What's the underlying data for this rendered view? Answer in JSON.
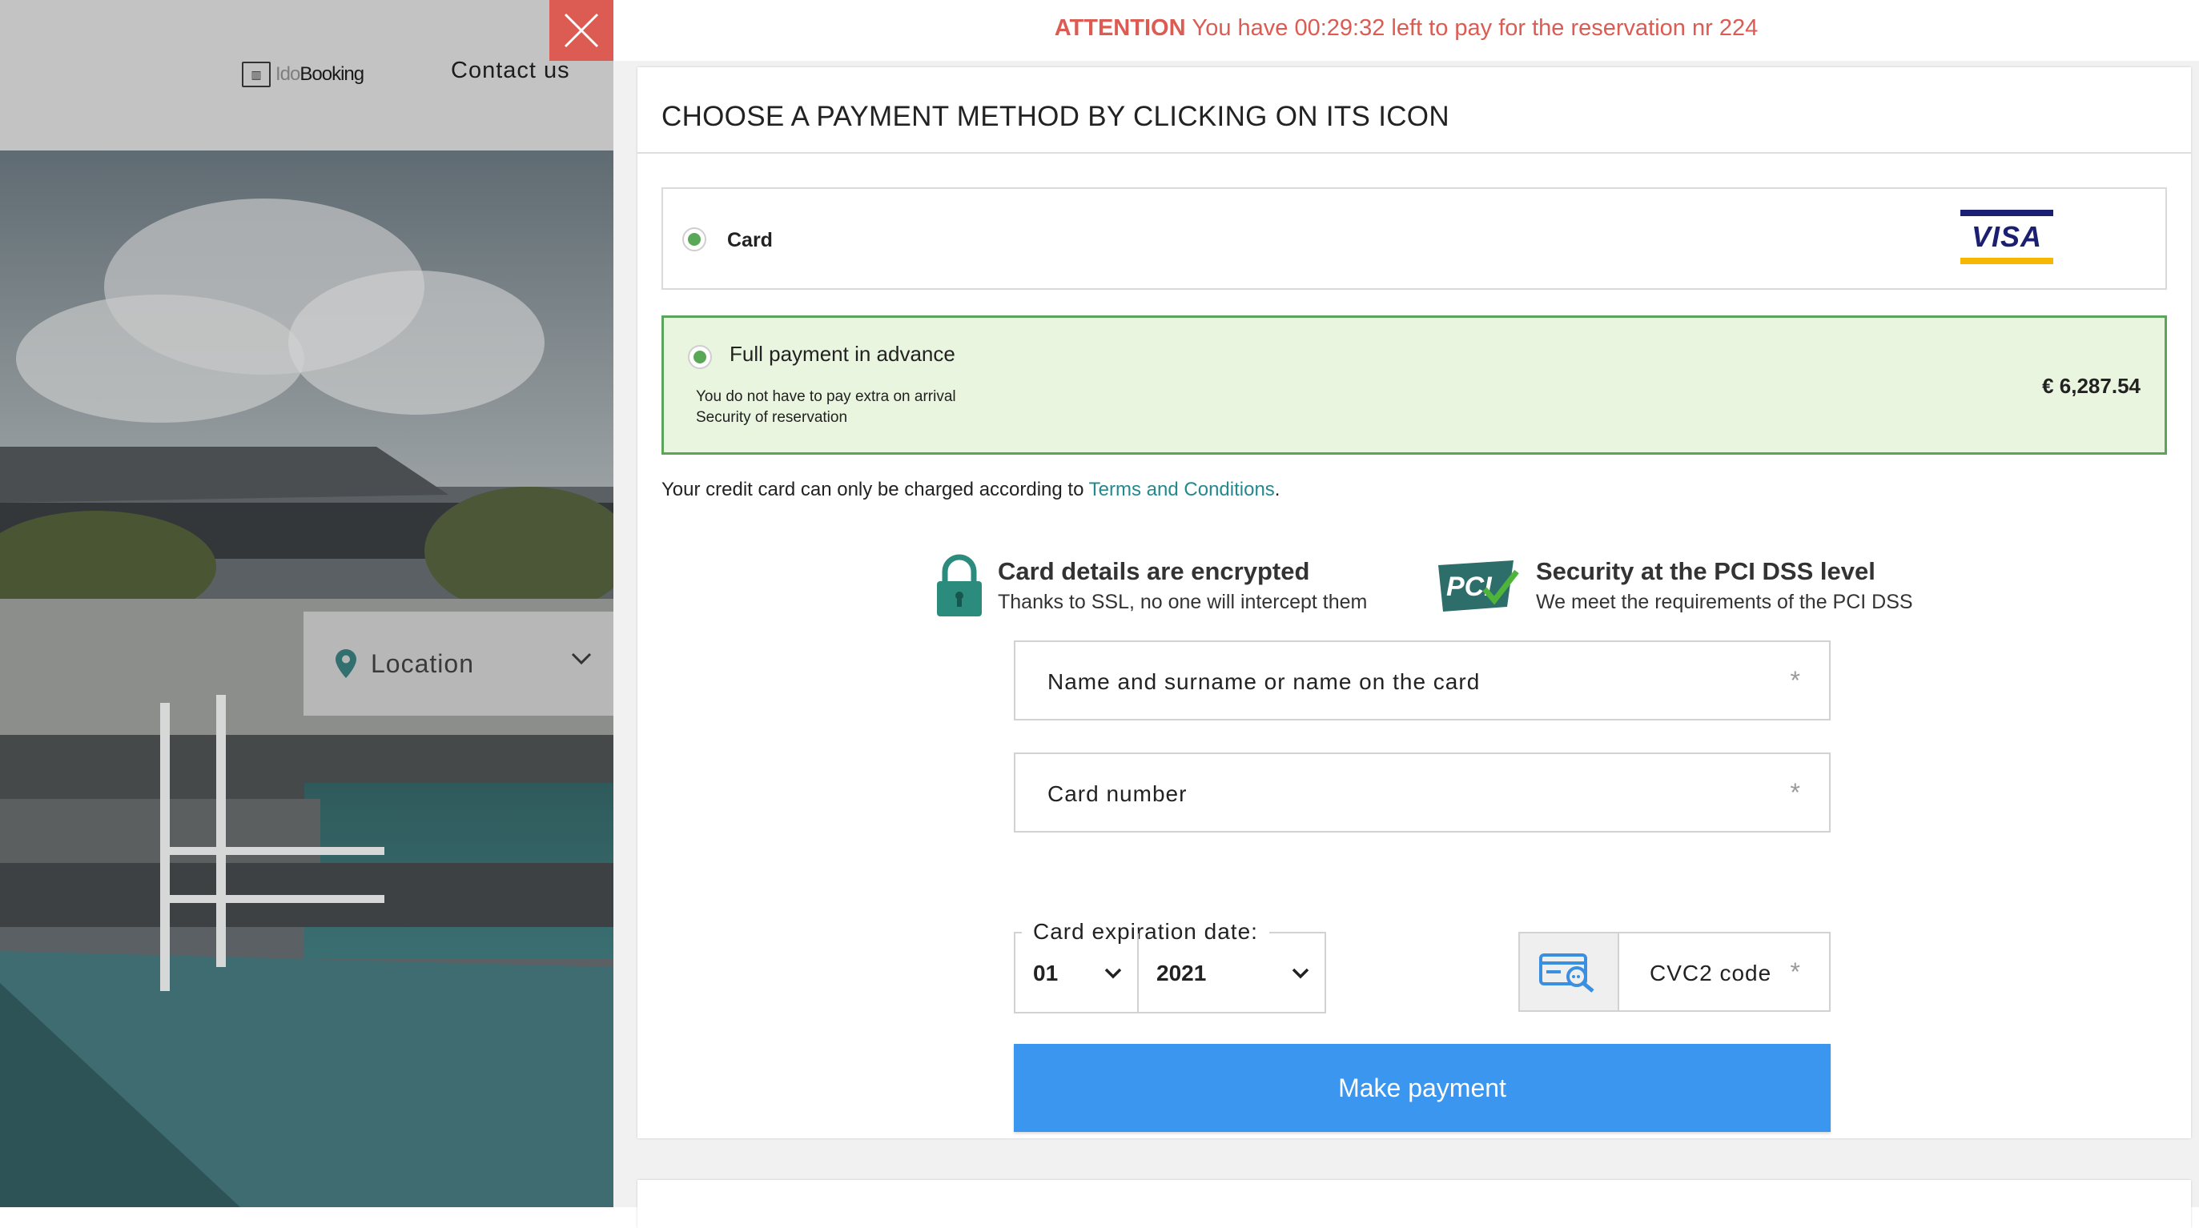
{
  "header": {
    "logo_text_ido": "Ido",
    "logo_text_booking": "Booking",
    "contact_label": "Contact us"
  },
  "location": {
    "label": "Location"
  },
  "attention": {
    "label": "ATTENTION",
    "message": "You have 00:29:32 left to pay for the reservation nr 224"
  },
  "payment": {
    "title": "CHOOSE A PAYMENT METHOD BY CLICKING ON ITS ICON",
    "method": {
      "label": "Card",
      "brand": "VISA"
    },
    "option": {
      "title": "Full payment in advance",
      "line1": "You do not have to pay extra on arrival",
      "line2": "Security of reservation",
      "price": "€ 6,287.54"
    },
    "terms_prefix": "Your credit card can only be charged according to ",
    "terms_link": "Terms and Conditions",
    "terms_suffix": "."
  },
  "security": {
    "ssl_title": "Card details are encrypted",
    "ssl_sub": "Thanks to SSL, no one will intercept them",
    "pci_title": "Security at the PCI DSS level",
    "pci_sub": "We meet the requirements of the PCI DSS",
    "pci_logo_text": "PCI"
  },
  "form": {
    "name_placeholder": "Name and surname or name on the card",
    "number_placeholder": "Card number",
    "required_mark": "*",
    "expiration_label": "Card expiration date:",
    "month_value": "01",
    "year_value": "2021",
    "cvc_label": "CVC2 code",
    "submit_label": "Make payment"
  },
  "colors": {
    "attention": "#dc5b52",
    "accent_green": "#5aa55a",
    "button_blue": "#3a96ef",
    "link_teal": "#23898f"
  }
}
